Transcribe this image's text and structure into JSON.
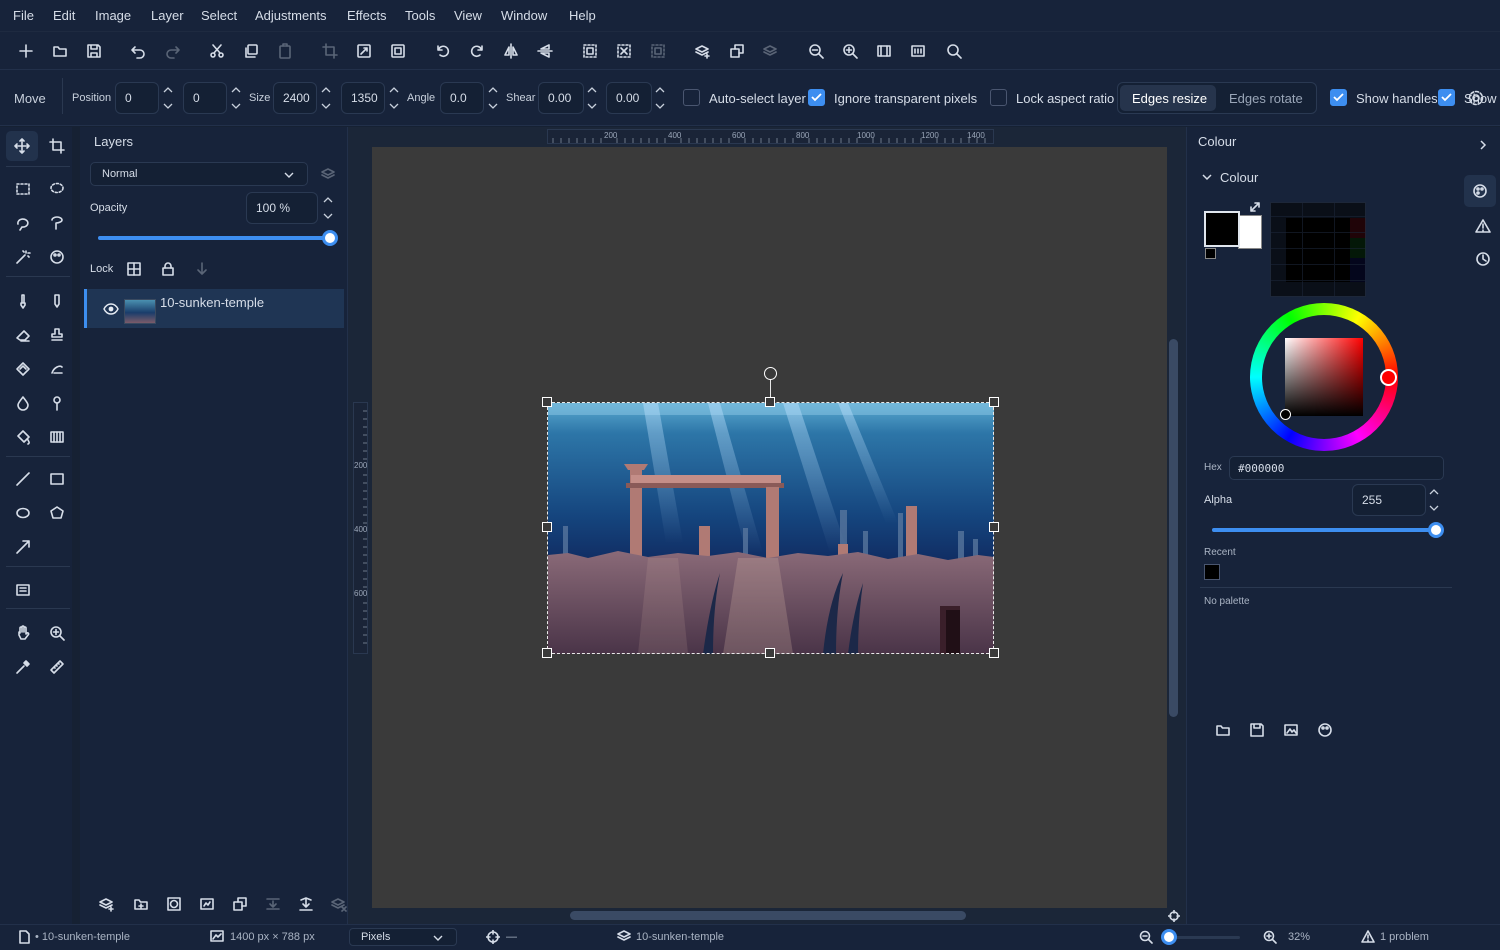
{
  "menu": [
    "File",
    "Edit",
    "Image",
    "Layer",
    "Select",
    "Adjustments",
    "Effects",
    "Tools",
    "View",
    "Window",
    "Help"
  ],
  "tool_options": {
    "tool_name": "Move",
    "position_label": "Position",
    "pos_x": "0",
    "pos_y": "0",
    "size_label": "Size",
    "width": "2400",
    "height": "1350",
    "angle_label": "Angle",
    "angle": "0.0",
    "shear_label": "Shear",
    "shear_x": "0.00",
    "shear_y": "0.00",
    "auto_select": {
      "label": "Auto-select layer",
      "checked": false
    },
    "ignore_transparent": {
      "label": "Ignore transparent pixels",
      "checked": true
    },
    "lock_aspect": {
      "label": "Lock aspect ratio",
      "checked": false
    },
    "edges_resize": "Edges resize",
    "edges_rotate": "Edges rotate",
    "show_handles": {
      "label": "Show handles",
      "checked": true
    },
    "show_cut": "Show"
  },
  "layers": {
    "title": "Layers",
    "blend_mode": "Normal",
    "opacity_label": "Opacity",
    "opacity_value": "100 %",
    "opacity_fraction": 1.0,
    "lock_label": "Lock",
    "items": [
      {
        "name": "10-sunken-temple",
        "visible": true,
        "selected": true
      }
    ]
  },
  "canvas": {
    "ruler_h_ticks": [
      "200",
      "400",
      "600",
      "800",
      "1000",
      "1200",
      "1400"
    ],
    "ruler_v_ticks": [
      "200",
      "400",
      "600"
    ]
  },
  "colour": {
    "panel_title": "Colour",
    "section_title": "Colour",
    "hex_label": "Hex",
    "hex_value": "#000000",
    "alpha_label": "Alpha",
    "alpha_value": "255",
    "alpha_fraction": 1.0,
    "recent_label": "Recent",
    "no_palette": "No palette",
    "primary": "#000000",
    "secondary": "#ffffff"
  },
  "status": {
    "document": "• 10-sunken-temple",
    "image_size": "1400 px × 788 px",
    "units": "Pixels",
    "cursor": "—",
    "layer": "10-sunken-temple",
    "zoom": "32%",
    "problems": "1 problem"
  },
  "colors": {
    "accent": "#3d8ef0",
    "panel": "#17233a",
    "canvas_bg": "#3a3a3a"
  }
}
